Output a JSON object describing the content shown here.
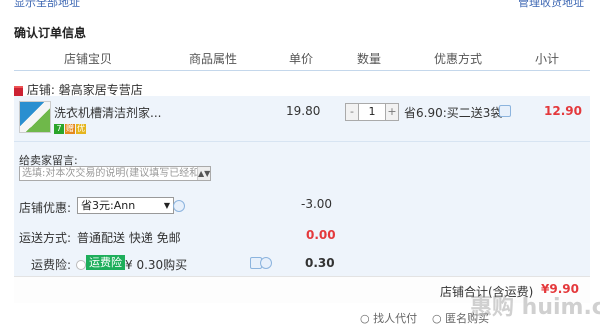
{
  "top_links": {
    "left": "显示全部地址",
    "right": "管理收货地址"
  },
  "section_title": "确认订单信息",
  "columns": [
    "店铺宝贝",
    "商品属性",
    "单价",
    "数量",
    "优惠方式",
    "小计"
  ],
  "shop": {
    "label": "店铺:",
    "name": "磐高家居专营店"
  },
  "item": {
    "title": "洗衣机槽清洁剂家...",
    "badges": [
      "7",
      "赠",
      "优"
    ],
    "price": "19.80",
    "quantity": "1",
    "qty_minus": "-",
    "qty_plus": "+",
    "promo": "省6.90:买二送3袋",
    "subtotal": "12.90"
  },
  "remark": {
    "label": "给卖家留言:",
    "placeholder": "选填:对本次交易的说明(建议填写已经和卖家达成一致的说明)"
  },
  "shop_discount": {
    "label": "店铺优惠:",
    "selected": "省3元:Ann",
    "amount": "-3.00"
  },
  "shipping": {
    "label": "运送方式:",
    "value": "普通配送 快递 免邮",
    "amount": "0.00"
  },
  "insurance": {
    "label": "运费险:",
    "tag": "运费险",
    "text": "¥ 0.30购买",
    "amount": "0.30"
  },
  "total": {
    "label": "店铺合计(含运费)",
    "value": "¥9.90"
  },
  "bottom_hint": {
    "text1": "找人代付",
    "text2": "匿名购买"
  },
  "watermark": "惠购 huim.com"
}
